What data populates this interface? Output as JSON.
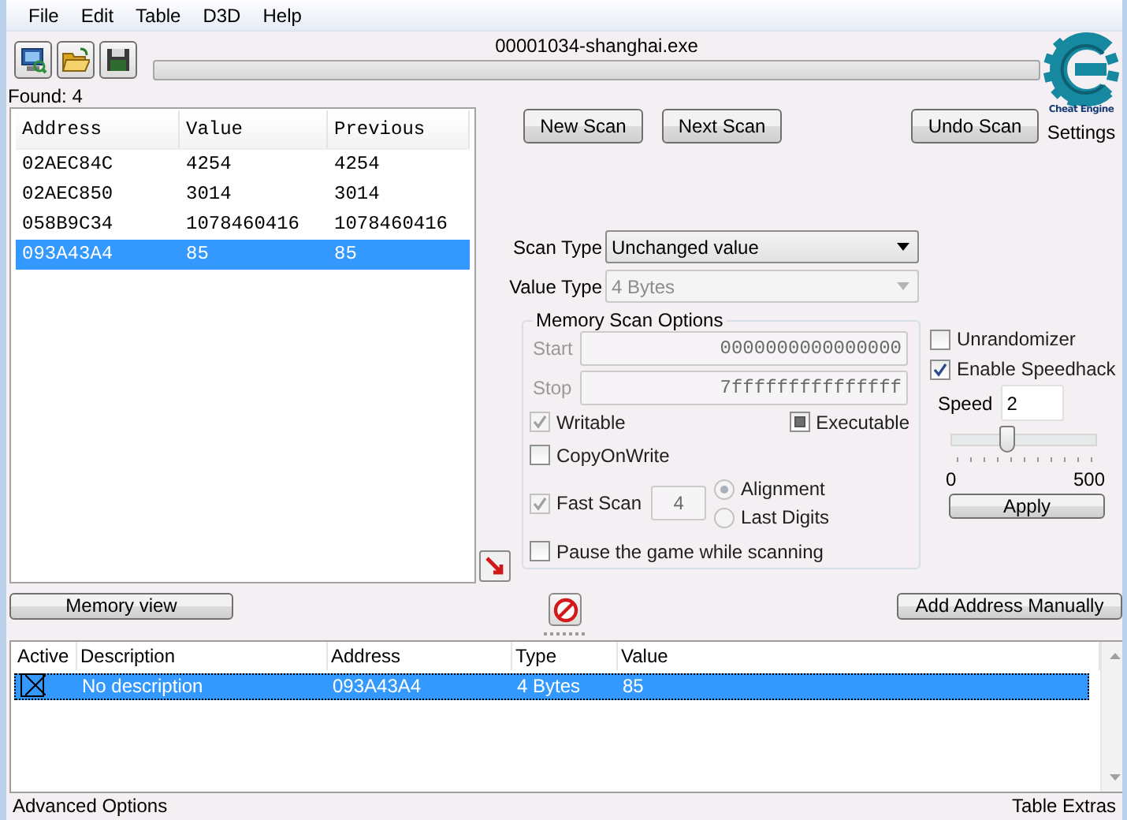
{
  "menu": [
    "File",
    "Edit",
    "Table",
    "D3D",
    "Help"
  ],
  "process": {
    "title": "00001034-shanghai.exe",
    "progress": {
      "level": 0
    }
  },
  "logo": {
    "caption": "Cheat Engine",
    "settings": "Settings"
  },
  "found": "Found: 4",
  "results": {
    "columns": [
      "Address",
      "Value",
      "Previous"
    ],
    "rows": [
      {
        "address": "02AEC84C",
        "value": "4254",
        "previous": "4254",
        "selected": false
      },
      {
        "address": "02AEC850",
        "value": "3014",
        "previous": "3014",
        "selected": false
      },
      {
        "address": "058B9C34",
        "value": "1078460416",
        "previous": "1078460416",
        "selected": false
      },
      {
        "address": "093A43A4",
        "value": "85",
        "previous": "85",
        "selected": true
      }
    ]
  },
  "scan_buttons": [
    "New Scan",
    "Next Scan",
    "Undo Scan"
  ],
  "scan_type": {
    "label": "Scan Type",
    "value": "Unchanged value",
    "disabled": false
  },
  "value_type": {
    "label": "Value Type",
    "value": "4 Bytes",
    "disabled": true
  },
  "memory_scan_options": {
    "title": "Memory Scan Options",
    "start": {
      "label": "Start",
      "value": "0000000000000000",
      "disabled": true
    },
    "stop": {
      "label": "Stop",
      "value": "7fffffffffffffff",
      "disabled": true
    },
    "writable": {
      "label": "Writable",
      "checked": true,
      "disabled": true
    },
    "executable": {
      "label": "Executable",
      "indeterminate": true,
      "disabled": false
    },
    "copy_on_write": {
      "label": "CopyOnWrite",
      "checked": false,
      "disabled": false
    },
    "fast_scan": {
      "label": "Fast Scan",
      "checked": true,
      "disabled": true,
      "value": "4"
    },
    "alignment": [
      {
        "label": "Alignment",
        "selected": true
      },
      {
        "label": "Last Digits",
        "selected": false
      }
    ],
    "pause": {
      "label": "Pause the game while scanning",
      "checked": false,
      "disabled": false
    }
  },
  "speedhack": {
    "unrandomizer": {
      "label": "Unrandomizer",
      "checked": false
    },
    "enable": {
      "label": "Enable Speedhack",
      "checked": true
    },
    "speed_label": "Speed",
    "speed": "2",
    "slider": {
      "level": 0.37
    },
    "min": "0",
    "max": "500",
    "apply": "Apply"
  },
  "memory_view": "Memory view",
  "add_address": "Add Address Manually",
  "address_list": {
    "columns": [
      "Active",
      "Description",
      "Address",
      "Type",
      "Value"
    ],
    "rows": [
      {
        "active": true,
        "description": "No description",
        "address": "093A43A4",
        "type": "4 Bytes",
        "value": "85",
        "selected": true
      }
    ]
  },
  "footer": {
    "left": "Advanced Options",
    "right": "Table Extras"
  }
}
